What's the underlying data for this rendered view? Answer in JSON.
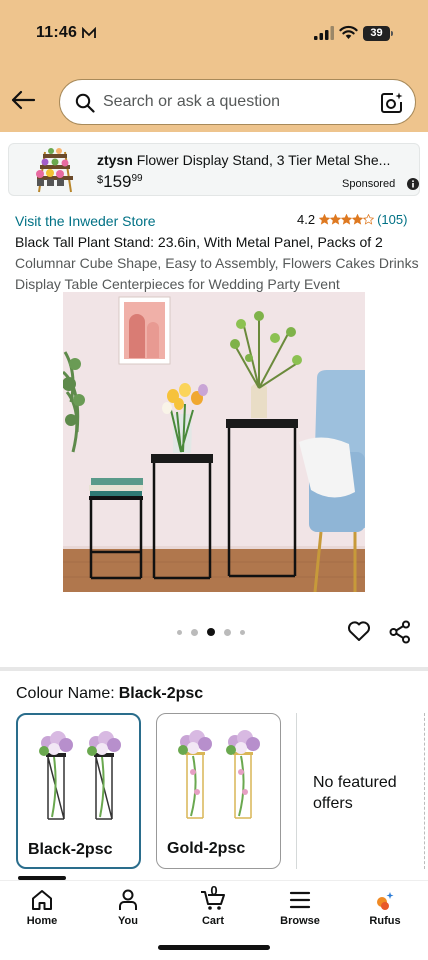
{
  "status_bar": {
    "time": "11:46",
    "battery": "39"
  },
  "search": {
    "placeholder": "Search or ask a question"
  },
  "ad": {
    "brand": "ztysn",
    "title": "Flower Display Stand, 3 Tier Metal She...",
    "currency": "$",
    "price_whole": "159",
    "price_fraction": "99",
    "sponsored_label": "Sponsored"
  },
  "product": {
    "store_link": "Visit the Inweder Store",
    "rating": "4.2",
    "rating_value": 4.2,
    "review_count": "(105)",
    "title_main": "Black Tall Plant Stand: 23.6in, With Metal Panel, Packs of 2",
    "title_sub": "Columnar Cube Shape, Easy to Assembly, Flowers Cakes Drinks Display Table Centerpieces for Wedding Party Event",
    "image_count": 5,
    "active_image": 3
  },
  "variation": {
    "label": "Colour Name:",
    "selected": "Black-2psc",
    "options": [
      {
        "label": "Black-2psc"
      },
      {
        "label": "Gold-2psc"
      }
    ],
    "no_offers": "No featured offers"
  },
  "bottom_nav": {
    "home": "Home",
    "you": "You",
    "cart": "Cart",
    "cart_count": "0",
    "browse": "Browse",
    "rufus": "Rufus"
  },
  "colors": {
    "header_bg": "#eec48d",
    "link": "#007185",
    "star": "#de7921",
    "selected_border": "#2a6d8c"
  }
}
